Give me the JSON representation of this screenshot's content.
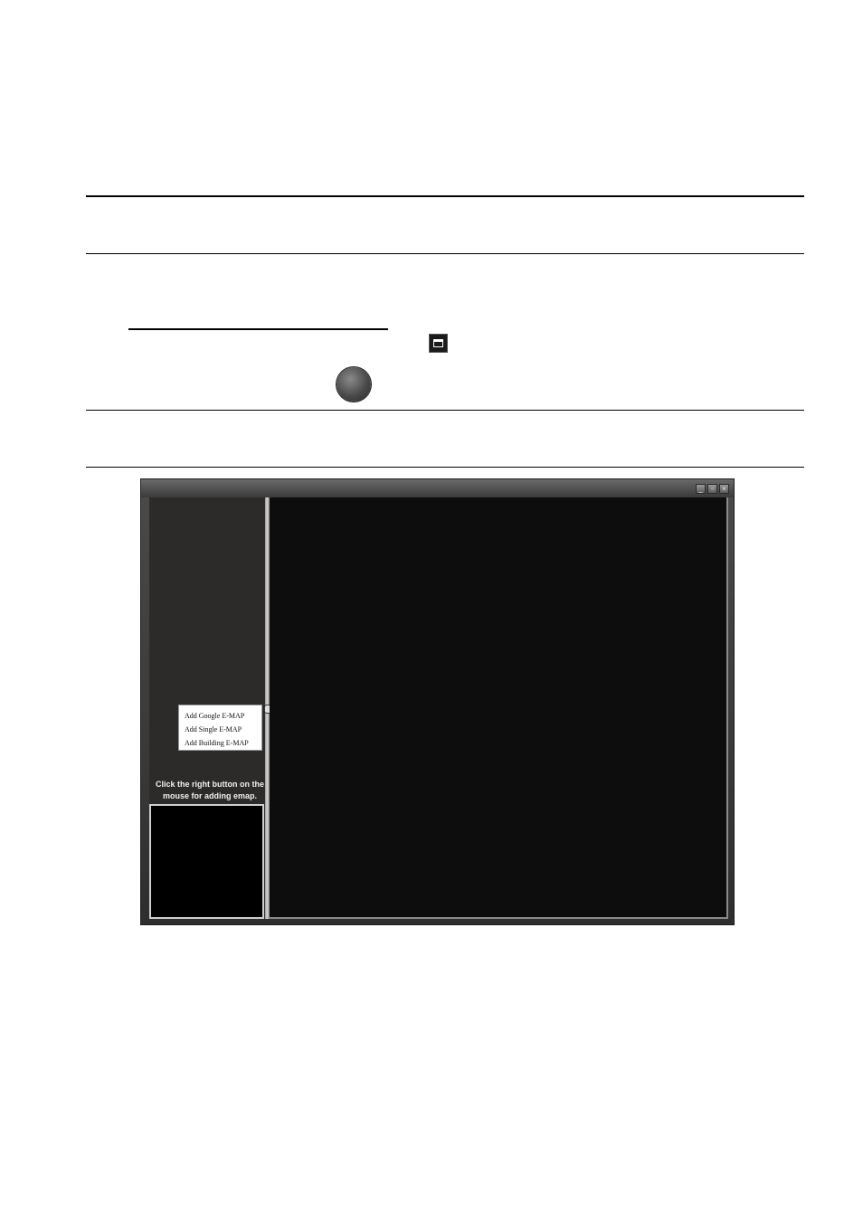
{
  "doc": {
    "window_buttons": {
      "minimize": "_",
      "maximize": "▫",
      "close": "×"
    }
  },
  "sidebar": {
    "context_menu": [
      {
        "label": "Add Google E-MAP"
      },
      {
        "label": "Add Single E-MAP"
      },
      {
        "label": "Add Building E-MAP"
      }
    ],
    "hint_line1": "Click the right button on the",
    "hint_line2": "mouse for adding emap."
  },
  "icons": {
    "window_icon": "window-icon",
    "emap_button": "emap-button-icon"
  }
}
